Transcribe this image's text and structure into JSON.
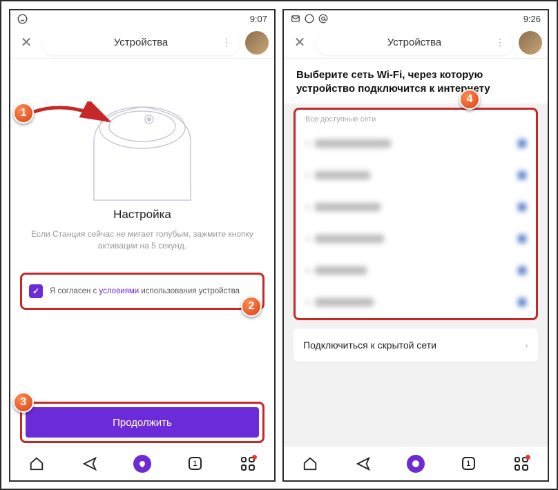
{
  "left": {
    "time": "9:07",
    "header_title": "Устройства",
    "setup_title": "Настройка",
    "setup_desc": "Если Станция сейчас не мигает голубым, зажмите кнопку активации на 5 секунд.",
    "consent_prefix": "Я согласен с ",
    "consent_link": "условиями",
    "consent_suffix": " использования устройства",
    "continue_label": "Продолжить",
    "nav_count": "1"
  },
  "right": {
    "time": "9:26",
    "header_title": "Устройства",
    "prompt": "Выберите сеть Wi-Fi, через которую устройство подключится к интернету",
    "networks_label": "Все доступные сети",
    "hidden_label": "Подключиться к скрытой сети",
    "nav_count": "1"
  },
  "markers": {
    "m1": "1",
    "m2": "2",
    "m3": "3",
    "m4": "4"
  }
}
